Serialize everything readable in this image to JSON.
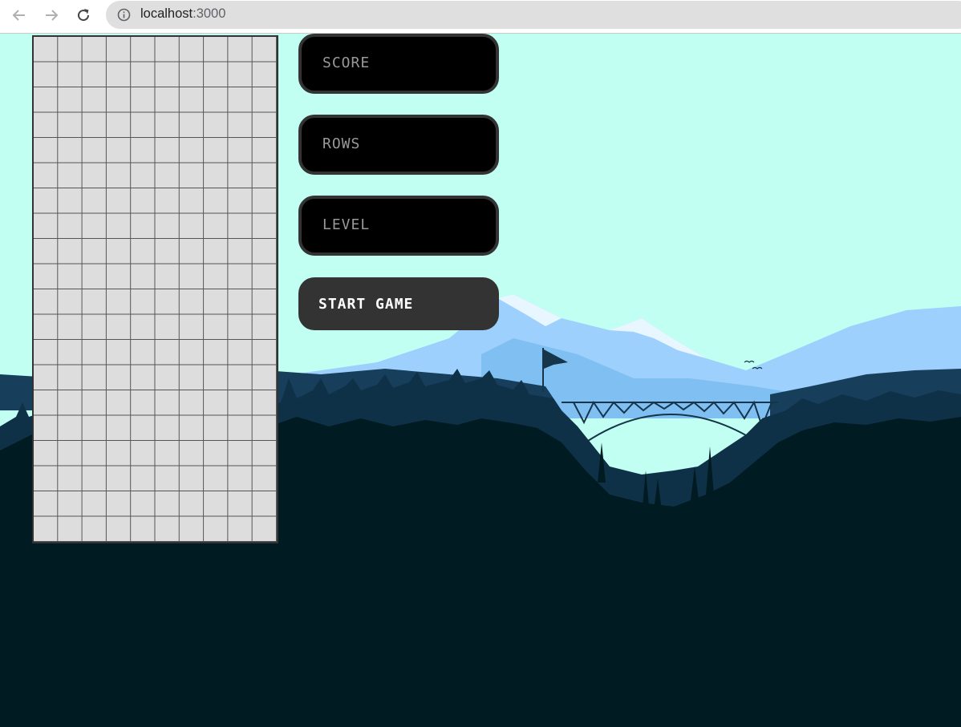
{
  "browser": {
    "host": "localhost",
    "port": ":3000",
    "icons": {
      "back": "back-arrow-icon",
      "forward": "forward-arrow-icon",
      "reload": "reload-icon",
      "info": "info-icon"
    }
  },
  "game": {
    "grid": {
      "columns": 10,
      "rows": 20
    },
    "displays": [
      {
        "label": "SCORE"
      },
      {
        "label": "ROWS"
      },
      {
        "label": "LEVEL"
      }
    ],
    "start_button_label": "START GAME"
  },
  "colors": {
    "sky": "#c1fff2",
    "grid_cell": "#dddddd",
    "panel": "#000000",
    "button": "#333333",
    "forest_dark": "#011b22"
  }
}
